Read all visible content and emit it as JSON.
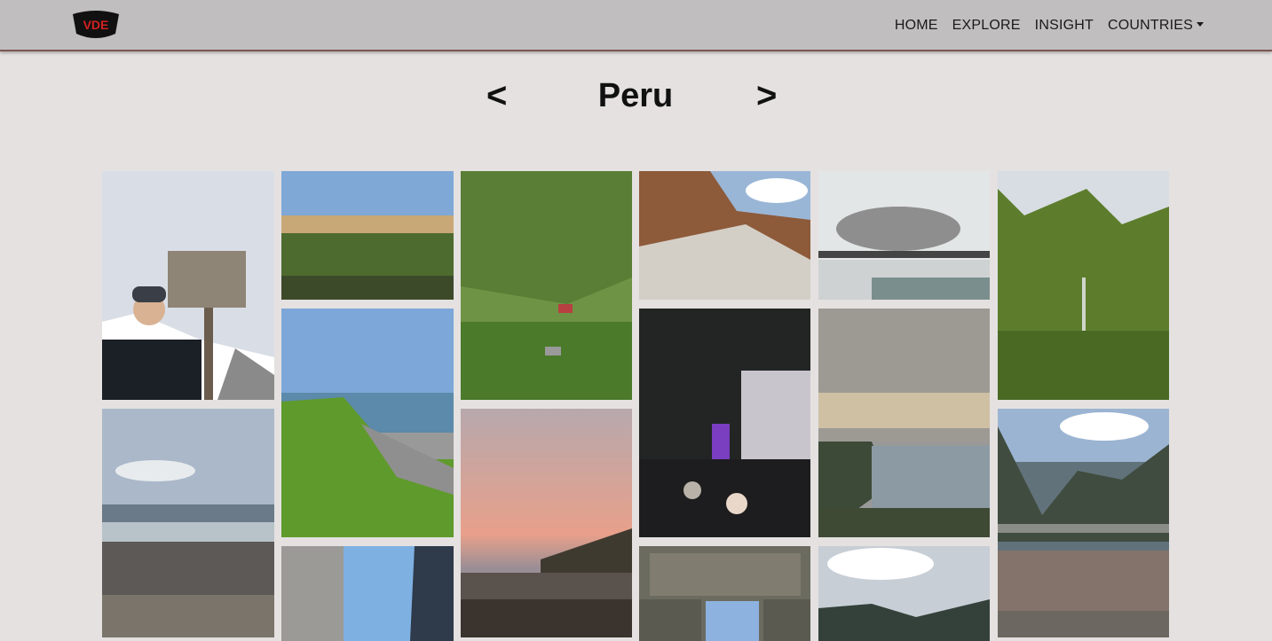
{
  "nav": {
    "logo_text": "VDE",
    "items": [
      {
        "label": "HOME"
      },
      {
        "label": "EXPLORE"
      },
      {
        "label": "INSIGHT"
      },
      {
        "label": "COUNTRIES"
      }
    ]
  },
  "gallery": {
    "prev_label": "<",
    "next_label": ">",
    "country": "Peru"
  },
  "colors": {
    "navbar_bg": "#c0bebe",
    "page_bg": "#e4e1e0",
    "nav_border": "#7a5656"
  }
}
